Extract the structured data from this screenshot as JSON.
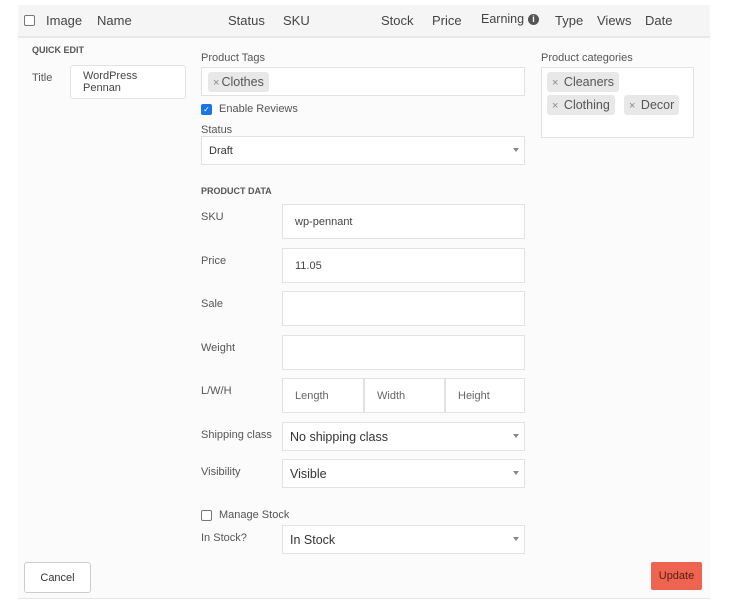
{
  "table_header": {
    "columns": [
      "Image",
      "Name",
      "Status",
      "SKU",
      "Stock",
      "Price",
      "Earning",
      "Type",
      "Views",
      "Date"
    ]
  },
  "quick_edit": {
    "heading": "QUICK EDIT",
    "title_label": "Title",
    "title_value": "WordPress Pennan",
    "tags_label": "Product Tags",
    "tags": [
      "Clothes"
    ],
    "enable_reviews_label": "Enable Reviews",
    "enable_reviews_checked": true,
    "status_label": "Status",
    "status_value": "Draft",
    "categories_label": "Product categories",
    "categories": [
      "Cleaners",
      "Clothing",
      "Decor"
    ],
    "product_data_heading": "PRODUCT DATA",
    "sku_label": "SKU",
    "sku_value": "wp-pennant",
    "price_label": "Price",
    "price_value": "11.05",
    "sale_label": "Sale",
    "sale_value": "",
    "weight_label": "Weight",
    "weight_value": "",
    "lwh_label": "L/W/H",
    "length_placeholder": "Length",
    "width_placeholder": "Width",
    "height_placeholder": "Height",
    "shipping_label": "Shipping class",
    "shipping_value": "No shipping class",
    "visibility_label": "Visibility",
    "visibility_value": "Visible",
    "manage_stock_label": "Manage Stock",
    "manage_stock_checked": false,
    "in_stock_label": "In Stock?",
    "in_stock_value": "In Stock",
    "cancel_label": "Cancel",
    "update_label": "Update"
  },
  "colors": {
    "update_button": "#ef6351",
    "checkbox_accent": "#1a73e8"
  }
}
